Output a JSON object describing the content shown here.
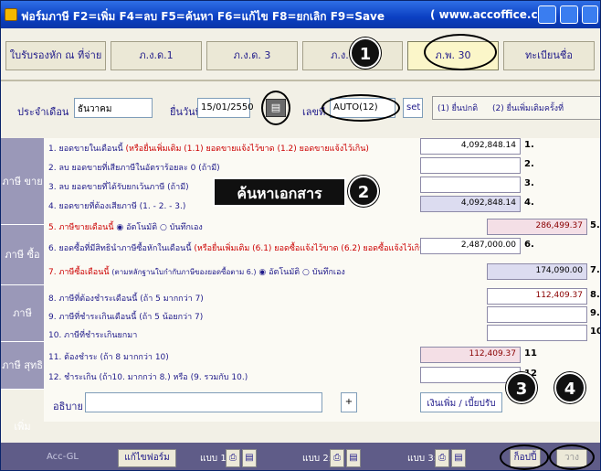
{
  "title": {
    "text": "ฟอร์มภาษี F2=เพิ่ม F4=ลบ F5=ค้นหา F6=แก้ไข F8=ยกเลิก F9=Save",
    "url": "( www.accoffice.com )"
  },
  "tabs": [
    {
      "label": "ใบรับรองหัก ณ ที่จ่าย"
    },
    {
      "label": "ภ.ง.ด.1"
    },
    {
      "label": "ภ.ง.ด. 3"
    },
    {
      "label": "ภ.ง.ด. 53"
    },
    {
      "label": "ภ.พ. 30"
    },
    {
      "label": "ทะเบียนชื่อ"
    }
  ],
  "form": {
    "month_label": "ประจำเดือน",
    "month_value": "ธันวาคม",
    "date_label": "ยื่นวันที่",
    "date_value": "15/01/2550",
    "no_label": "เลขที่",
    "no_value": "AUTO(12)",
    "set_label": "set",
    "radio1": "(1) ยื่นปกติ",
    "radio2": "(2) ยื่นเพิ่มเติมครั้งที่"
  },
  "sections": {
    "sale": "ภาษี ขาย",
    "buy": "ภาษี ซื้อ",
    "vat": "ภาษี มูลค่า เพิ่ม",
    "net": "ภาษี สุทธิ"
  },
  "rows": [
    {
      "text": "1. ยอดขายในเดือนนี้",
      "note": "(หรือยื่นเพิ่มเติม (1.1) ยอดขายแจ้งไว้ขาด (1.2) ยอดขายแจ้งไว้เกิน)",
      "value": "4,092,848.14",
      "no": "1."
    },
    {
      "text": "2. ลบ ยอดขายที่เสียภาษีในอัตราร้อยละ 0 (ถ้ามี)",
      "no": "2."
    },
    {
      "text": "3. ลบ ยอดขายที่ได้รับยกเว้นภาษี (ถ้ามี)",
      "no": "3."
    },
    {
      "text": "4. ยอดขายที่ต้องเสียภาษี (1. - 2. - 3.)",
      "value": "4,092,848.14",
      "no": "4."
    },
    {
      "text": "5. ภาษีขายเดือนนี้",
      "opt1": "อัตโนมัติ",
      "opt2": "บันทึกเอง",
      "value": "286,499.37",
      "no": "5."
    },
    {
      "text": "6. ยอดซื้อที่มีสิทธินำภาษีซื้อหักในเดือนนี้",
      "note": "(หรือยื่นเพิ่มเติม (6.1) ยอดซื้อแจ้งไว้ขาด (6.2) ยอดซื้อแจ้งไว้เกิน)",
      "value": "2,487,000.00",
      "no": "6."
    },
    {
      "text": "7. ภาษีซื้อเดือนนี้",
      "note": "(ตามหลักฐานใบกำกับภาษีของยอดซื้อตาม 6.)",
      "opt1": "อัตโนมัติ",
      "opt2": "บันทึกเอง",
      "value": "174,090.00",
      "no": "7."
    },
    {
      "text": "8. ภาษีที่ต้องชำระเดือนนี้ (ถ้า 5 มากกว่า 7)",
      "value": "112,409.37",
      "no": "8."
    },
    {
      "text": "9. ภาษีที่ชำระเกินเดือนนี้ (ถ้า 5 น้อยกว่า 7)",
      "no": "9."
    },
    {
      "text": "10. ภาษีที่ชำระเกินยกมา",
      "no": "10"
    },
    {
      "text": "11. ต้องชำระ (ถ้า 8 มากกว่า 10)",
      "value": "112,409.37",
      "no": "11"
    },
    {
      "text": "12. ชำระเกิน (ถ้า10. มากกว่า 8.) หรือ (9. รวมกับ 10.)",
      "no": "12"
    }
  ],
  "desc_label": "อธิบาย",
  "plus_label": "+",
  "extra_label": "เงินเพิ่ม / เบี้ยปรับ",
  "search_label": "ค้นหาเอกสาร",
  "callouts": [
    "1",
    "2",
    "3",
    "4"
  ],
  "bottom": {
    "accgl": "Acc-GL",
    "edit_form": "แก้ไขฟอร์ม",
    "form1": "แบบ 1:",
    "form2": "แบบ 2:",
    "form3": "แบบ 3:",
    "copy": "ก็อปปี้",
    "paste": "วาง"
  }
}
